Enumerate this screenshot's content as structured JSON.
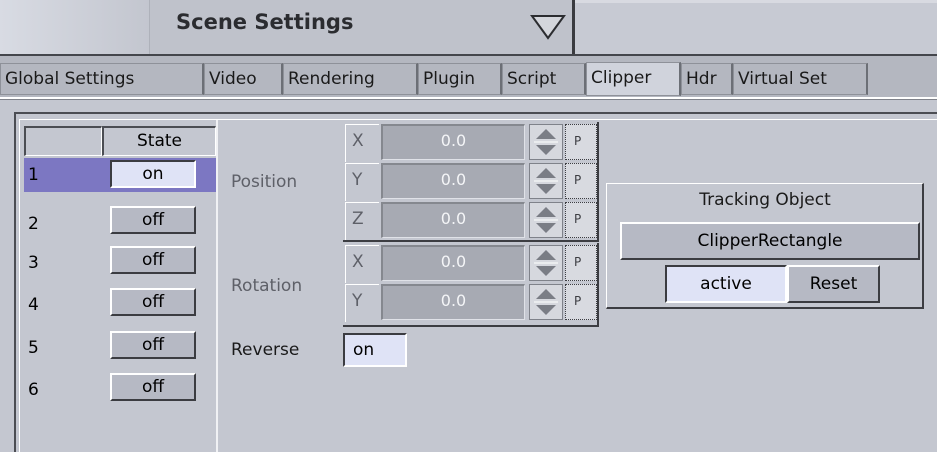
{
  "window": {
    "title": "Scene Settings"
  },
  "tabs": [
    {
      "label": "Global Settings",
      "active": false
    },
    {
      "label": "Video",
      "active": false
    },
    {
      "label": "Rendering",
      "active": false
    },
    {
      "label": "Plugin",
      "active": false
    },
    {
      "label": "Script",
      "active": false
    },
    {
      "label": "Clipper",
      "active": true
    },
    {
      "label": "Hdr",
      "active": false
    },
    {
      "label": "Virtual Set",
      "active": false
    }
  ],
  "clipper_table": {
    "header": {
      "index": "",
      "state": "State"
    },
    "rows": [
      {
        "index": "1",
        "state": "on",
        "selected": true
      },
      {
        "index": "2",
        "state": "off",
        "selected": false
      },
      {
        "index": "3",
        "state": "off",
        "selected": false
      },
      {
        "index": "4",
        "state": "off",
        "selected": false
      },
      {
        "index": "5",
        "state": "off",
        "selected": false
      },
      {
        "index": "6",
        "state": "off",
        "selected": false
      }
    ]
  },
  "position": {
    "label": "Position",
    "axes": [
      {
        "axis": "X",
        "value": "0.0"
      },
      {
        "axis": "Y",
        "value": "0.0"
      },
      {
        "axis": "Z",
        "value": "0.0"
      }
    ]
  },
  "rotation": {
    "label": "Rotation",
    "axes": [
      {
        "axis": "X",
        "value": "0.0"
      },
      {
        "axis": "Y",
        "value": "0.0"
      }
    ]
  },
  "reverse": {
    "label": "Reverse",
    "value": "on"
  },
  "tracking": {
    "title": "Tracking Object",
    "object_name": "ClipperRectangle",
    "active_label": "active",
    "reset_label": "Reset"
  },
  "icons": {
    "dropdown": "triangle-down-icon",
    "spinner": "spin-updown-icon",
    "grip": "drag-grip-icon"
  },
  "colors": {
    "selected_row": "#7c77c2",
    "on_button": "#dfe3f6",
    "panel": "#c4c7d0"
  }
}
